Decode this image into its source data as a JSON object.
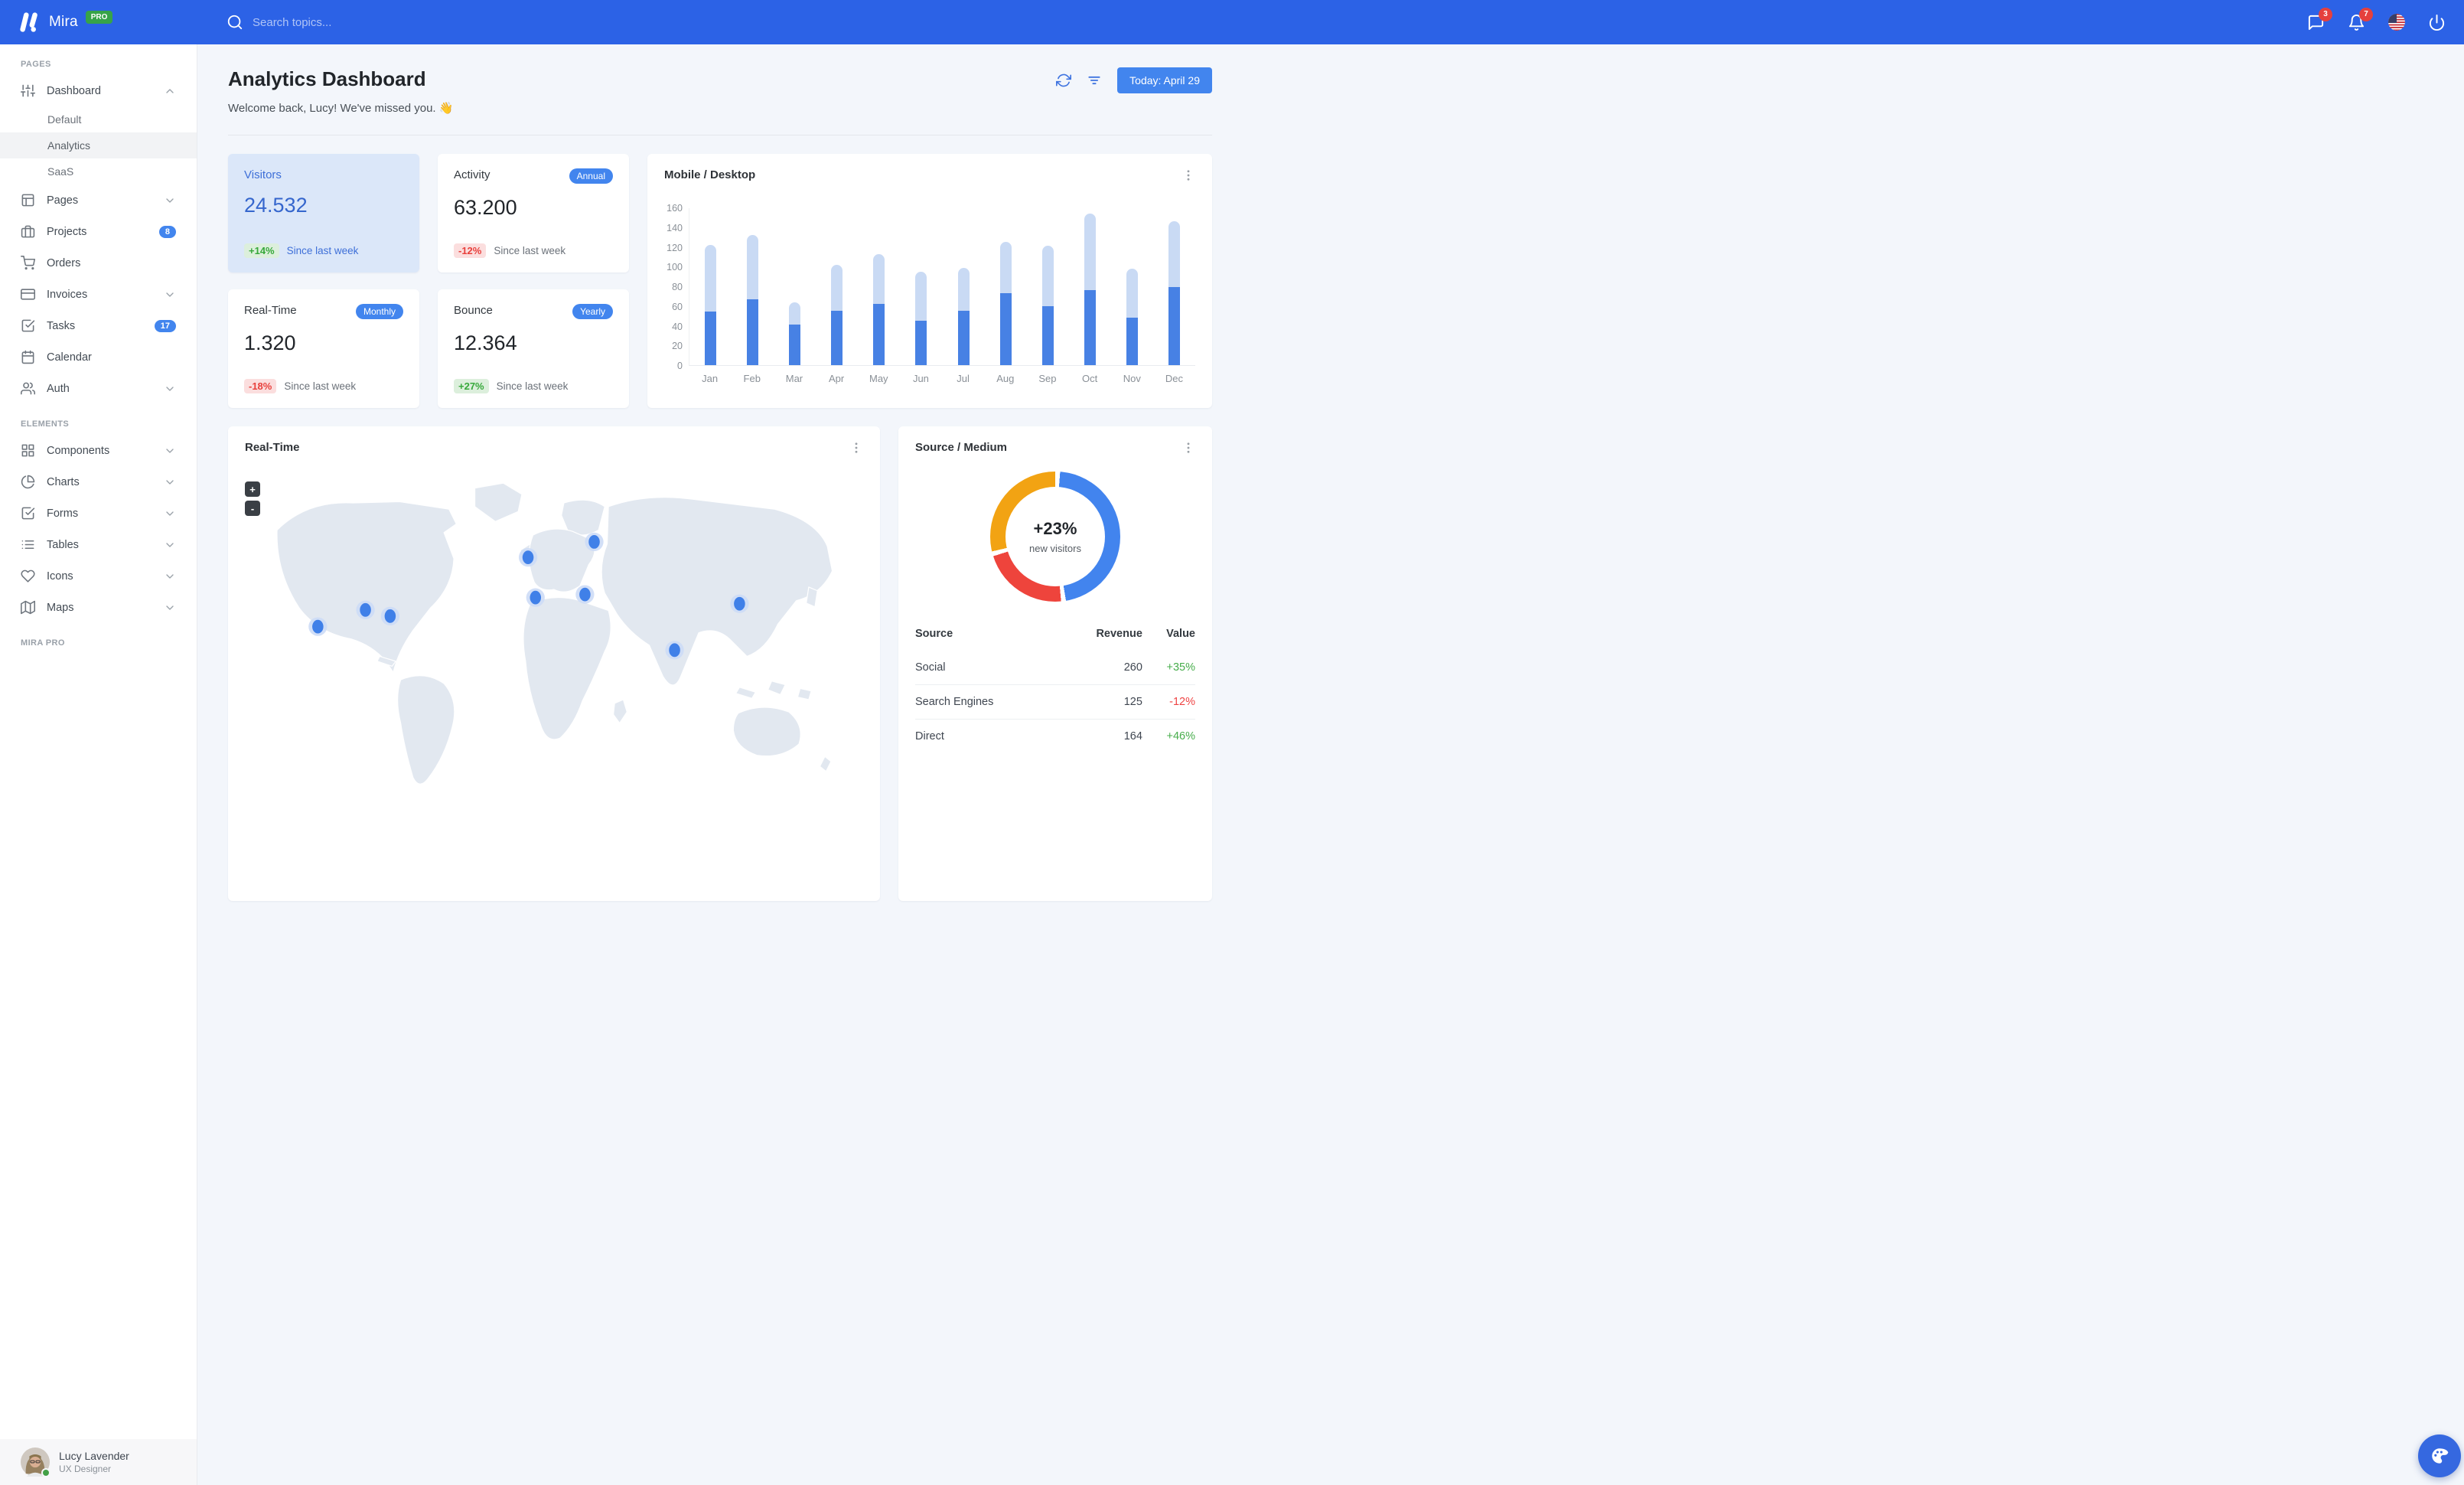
{
  "navbar": {
    "brand": "Mira",
    "brand_badge": "PRO",
    "search_placeholder": "Search topics...",
    "messages_badge": "3",
    "notifications_badge": "7",
    "icons": [
      "search-icon",
      "messages-icon",
      "notifications-icon",
      "us-flag-icon",
      "power-icon"
    ]
  },
  "sidebar": {
    "pages_label": "PAGES",
    "elements_label": "ELEMENTS",
    "pro_label": "MIRA PRO",
    "pages_items": [
      {
        "label": "Dashboard",
        "icon": "sliders-icon",
        "state": "expanded",
        "children": [
          {
            "label": "Default"
          },
          {
            "label": "Analytics",
            "active": true
          },
          {
            "label": "SaaS"
          }
        ]
      },
      {
        "label": "Pages",
        "icon": "layout-icon",
        "state": "collapsed"
      },
      {
        "label": "Projects",
        "icon": "briefcase-icon",
        "badge": "8"
      },
      {
        "label": "Orders",
        "icon": "shopping-cart-icon"
      },
      {
        "label": "Invoices",
        "icon": "credit-card-icon",
        "state": "collapsed"
      },
      {
        "label": "Tasks",
        "icon": "check-square-icon",
        "badge": "17"
      },
      {
        "label": "Calendar",
        "icon": "calendar-icon"
      },
      {
        "label": "Auth",
        "icon": "users-icon",
        "state": "collapsed"
      }
    ],
    "elements_items": [
      {
        "label": "Components",
        "icon": "grid-icon",
        "state": "collapsed"
      },
      {
        "label": "Charts",
        "icon": "pie-chart-icon",
        "state": "collapsed"
      },
      {
        "label": "Forms",
        "icon": "check-square-icon",
        "state": "collapsed"
      },
      {
        "label": "Tables",
        "icon": "list-icon",
        "state": "collapsed"
      },
      {
        "label": "Icons",
        "icon": "heart-icon",
        "state": "collapsed"
      },
      {
        "label": "Maps",
        "icon": "map-icon",
        "state": "collapsed"
      }
    ],
    "user": {
      "name": "Lucy Lavender",
      "role": "UX Designer",
      "status": "online"
    }
  },
  "header": {
    "title": "Analytics Dashboard",
    "welcome": "Welcome back, Lucy! We've missed you.",
    "welcome_emoji": "👋",
    "date_button": "Today: April 29",
    "action_icons": [
      "refresh-icon",
      "filter-icon"
    ]
  },
  "stats": [
    {
      "title": "Visitors",
      "value": "24.532",
      "delta": "+14%",
      "delta_type": "positive",
      "note": "Since last week",
      "highlighted": true
    },
    {
      "title": "Activity",
      "badge": "Annual",
      "value": "63.200",
      "delta": "-12%",
      "delta_type": "negative",
      "note": "Since last week"
    },
    {
      "title": "Real-Time",
      "badge": "Monthly",
      "value": "1.320",
      "delta": "-18%",
      "delta_type": "negative",
      "note": "Since last week"
    },
    {
      "title": "Bounce",
      "badge": "Yearly",
      "value": "12.364",
      "delta": "+27%",
      "delta_type": "positive",
      "note": "Since last week"
    }
  ],
  "chart_data": [
    {
      "type": "bar",
      "stacked": true,
      "title": "Mobile / Desktop",
      "categories": [
        "Jan",
        "Feb",
        "Mar",
        "Apr",
        "May",
        "Jun",
        "Jul",
        "Aug",
        "Sep",
        "Oct",
        "Nov",
        "Dec"
      ],
      "series": [
        {
          "name": "Mobile",
          "color": "#4781e4",
          "values": [
            54,
            67,
            41,
            55,
            62,
            45,
            55,
            73,
            60,
            76,
            48,
            79
          ]
        },
        {
          "name": "Desktop",
          "color": "#c9daf4",
          "values": [
            68,
            65,
            23,
            47,
            51,
            50,
            44,
            52,
            61,
            78,
            50,
            67
          ]
        }
      ],
      "ylim": [
        0,
        160
      ],
      "yticks": [
        0,
        20,
        40,
        60,
        80,
        100,
        120,
        140,
        160
      ],
      "grid": false,
      "legend": "none"
    },
    {
      "type": "donut",
      "title": "Source / Medium",
      "center_label": "+23%",
      "center_sublabel": "new visitors",
      "slices": [
        {
          "label": "Social",
          "value": 260,
          "color": "#4284ee"
        },
        {
          "label": "Search Engines",
          "value": 125,
          "color": "#ee443c"
        },
        {
          "label": "Direct",
          "value": 164,
          "color": "#f2a313"
        }
      ]
    }
  ],
  "map_card": {
    "title": "Real-Time",
    "zoom_in": "+",
    "zoom_out": "-",
    "marker_count": 9
  },
  "source_medium": {
    "title": "Source / Medium",
    "columns": [
      "Source",
      "Revenue",
      "Value"
    ],
    "rows": [
      {
        "source": "Social",
        "revenue": "260",
        "value": "+35%",
        "trend": "positive"
      },
      {
        "source": "Search Engines",
        "revenue": "125",
        "value": "-12%",
        "trend": "negative"
      },
      {
        "source": "Direct",
        "revenue": "164",
        "value": "+46%",
        "trend": "positive"
      }
    ]
  }
}
